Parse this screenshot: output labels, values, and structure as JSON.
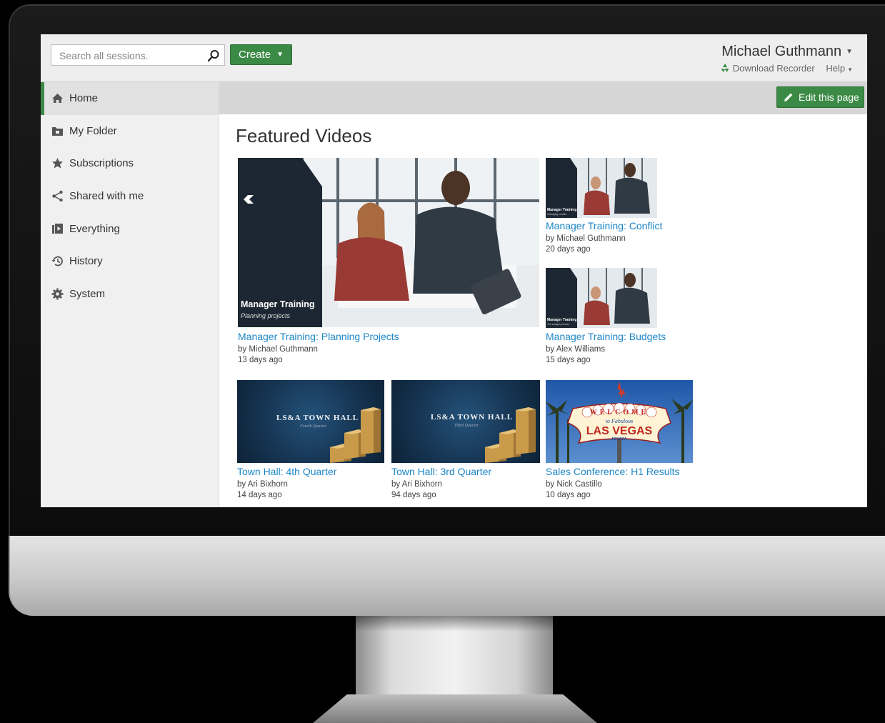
{
  "search": {
    "placeholder": "Search all sessions."
  },
  "toolbar": {
    "create_label": "Create"
  },
  "user": {
    "name": "Michael Guthmann",
    "download_recorder": "Download Recorder",
    "help": "Help"
  },
  "sidebar": {
    "items": [
      {
        "label": "Home",
        "icon": "home-icon"
      },
      {
        "label": "My Folder",
        "icon": "folder-icon"
      },
      {
        "label": "Subscriptions",
        "icon": "star-icon"
      },
      {
        "label": "Shared with me",
        "icon": "share-icon"
      },
      {
        "label": "Everything",
        "icon": "video-library-icon"
      },
      {
        "label": "History",
        "icon": "history-icon"
      },
      {
        "label": "System",
        "icon": "gear-icon"
      }
    ]
  },
  "edit_button": {
    "label": "Edit this page"
  },
  "main": {
    "section_title": "Featured Videos",
    "videos": [
      {
        "title": "Manager Training: Planning Projects",
        "author": "by Michael Guthmann",
        "age": "13 days ago",
        "thumb_title": "Manager Training",
        "thumb_subtitle": "Planning projects"
      },
      {
        "title": "Manager Training: Conflict",
        "author": "by Michael Guthmann",
        "age": "20 days ago",
        "thumb_title": "Manager Training",
        "thumb_subtitle": "Managing conflict"
      },
      {
        "title": "Manager Training: Budgets",
        "author": "by Alex Williams",
        "age": "15 days ago",
        "thumb_title": "Manager Training",
        "thumb_subtitle": "The budget process"
      },
      {
        "title": "Town Hall: 4th Quarter",
        "author": "by Ari Bixhorn",
        "age": "14 days ago",
        "thumb_title": "LS&A TOWN HALL",
        "thumb_subtitle": "Fourth Quarter"
      },
      {
        "title": "Town Hall: 3rd Quarter",
        "author": "by Ari Bixhorn",
        "age": "94 days ago",
        "thumb_title": "LS&A TOWN HALL",
        "thumb_subtitle": "Third Quarter"
      },
      {
        "title": "Sales Conference: H1 Results",
        "author": "by Nick Castillo",
        "age": "10 days ago",
        "thumb_sign_top": "WELCOME",
        "thumb_sign_mid": "to Fabulous",
        "thumb_sign_main": "LAS VEGAS",
        "thumb_sign_bottom": "NEVADA"
      }
    ]
  },
  "colors": {
    "accent": "#3b8a45",
    "link": "#1c86c7",
    "thumb_dark": "#1d2733",
    "townhall_bg": "#15324f"
  }
}
